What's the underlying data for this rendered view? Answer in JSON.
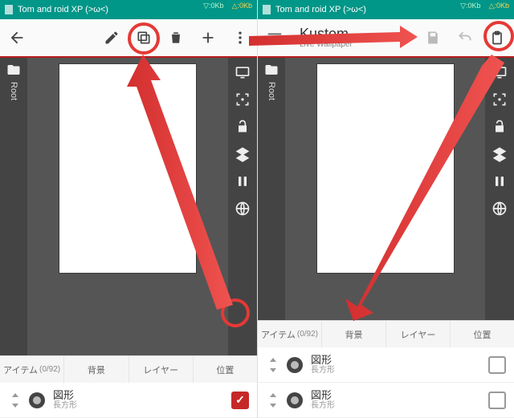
{
  "statusbar": {
    "title": "Tom and roid XP (>ω<)",
    "net_down": "▽:0Kb",
    "net_up": "△:0Kb"
  },
  "left": {
    "toolbar": {
      "back": "←",
      "pencil": "pencil",
      "copy": "copy",
      "trash": "trash",
      "plus": "+",
      "more": "⋮"
    },
    "root_label": "Root",
    "tabs": {
      "items_label": "アイテム",
      "items_count": "(0/92)",
      "bg": "背景",
      "layer": "レイヤー",
      "pos": "位置"
    },
    "rows": [
      {
        "title": "図形",
        "subtitle": "長方形",
        "checked": true
      }
    ]
  },
  "right": {
    "toolbar": {
      "menu": "≡",
      "title": "Kustom",
      "subtitle": "Live Wallpaper",
      "save": "save",
      "undo": "undo",
      "clip": "clipboard"
    },
    "root_label": "Root",
    "tabs": {
      "items_label": "アイテム",
      "items_count": "(0/92)",
      "bg": "背景",
      "layer": "レイヤー",
      "pos": "位置"
    },
    "rows": [
      {
        "title": "図形",
        "subtitle": "長方形",
        "checked": false
      },
      {
        "title": "図形",
        "subtitle": "長方形",
        "checked": false
      }
    ]
  }
}
